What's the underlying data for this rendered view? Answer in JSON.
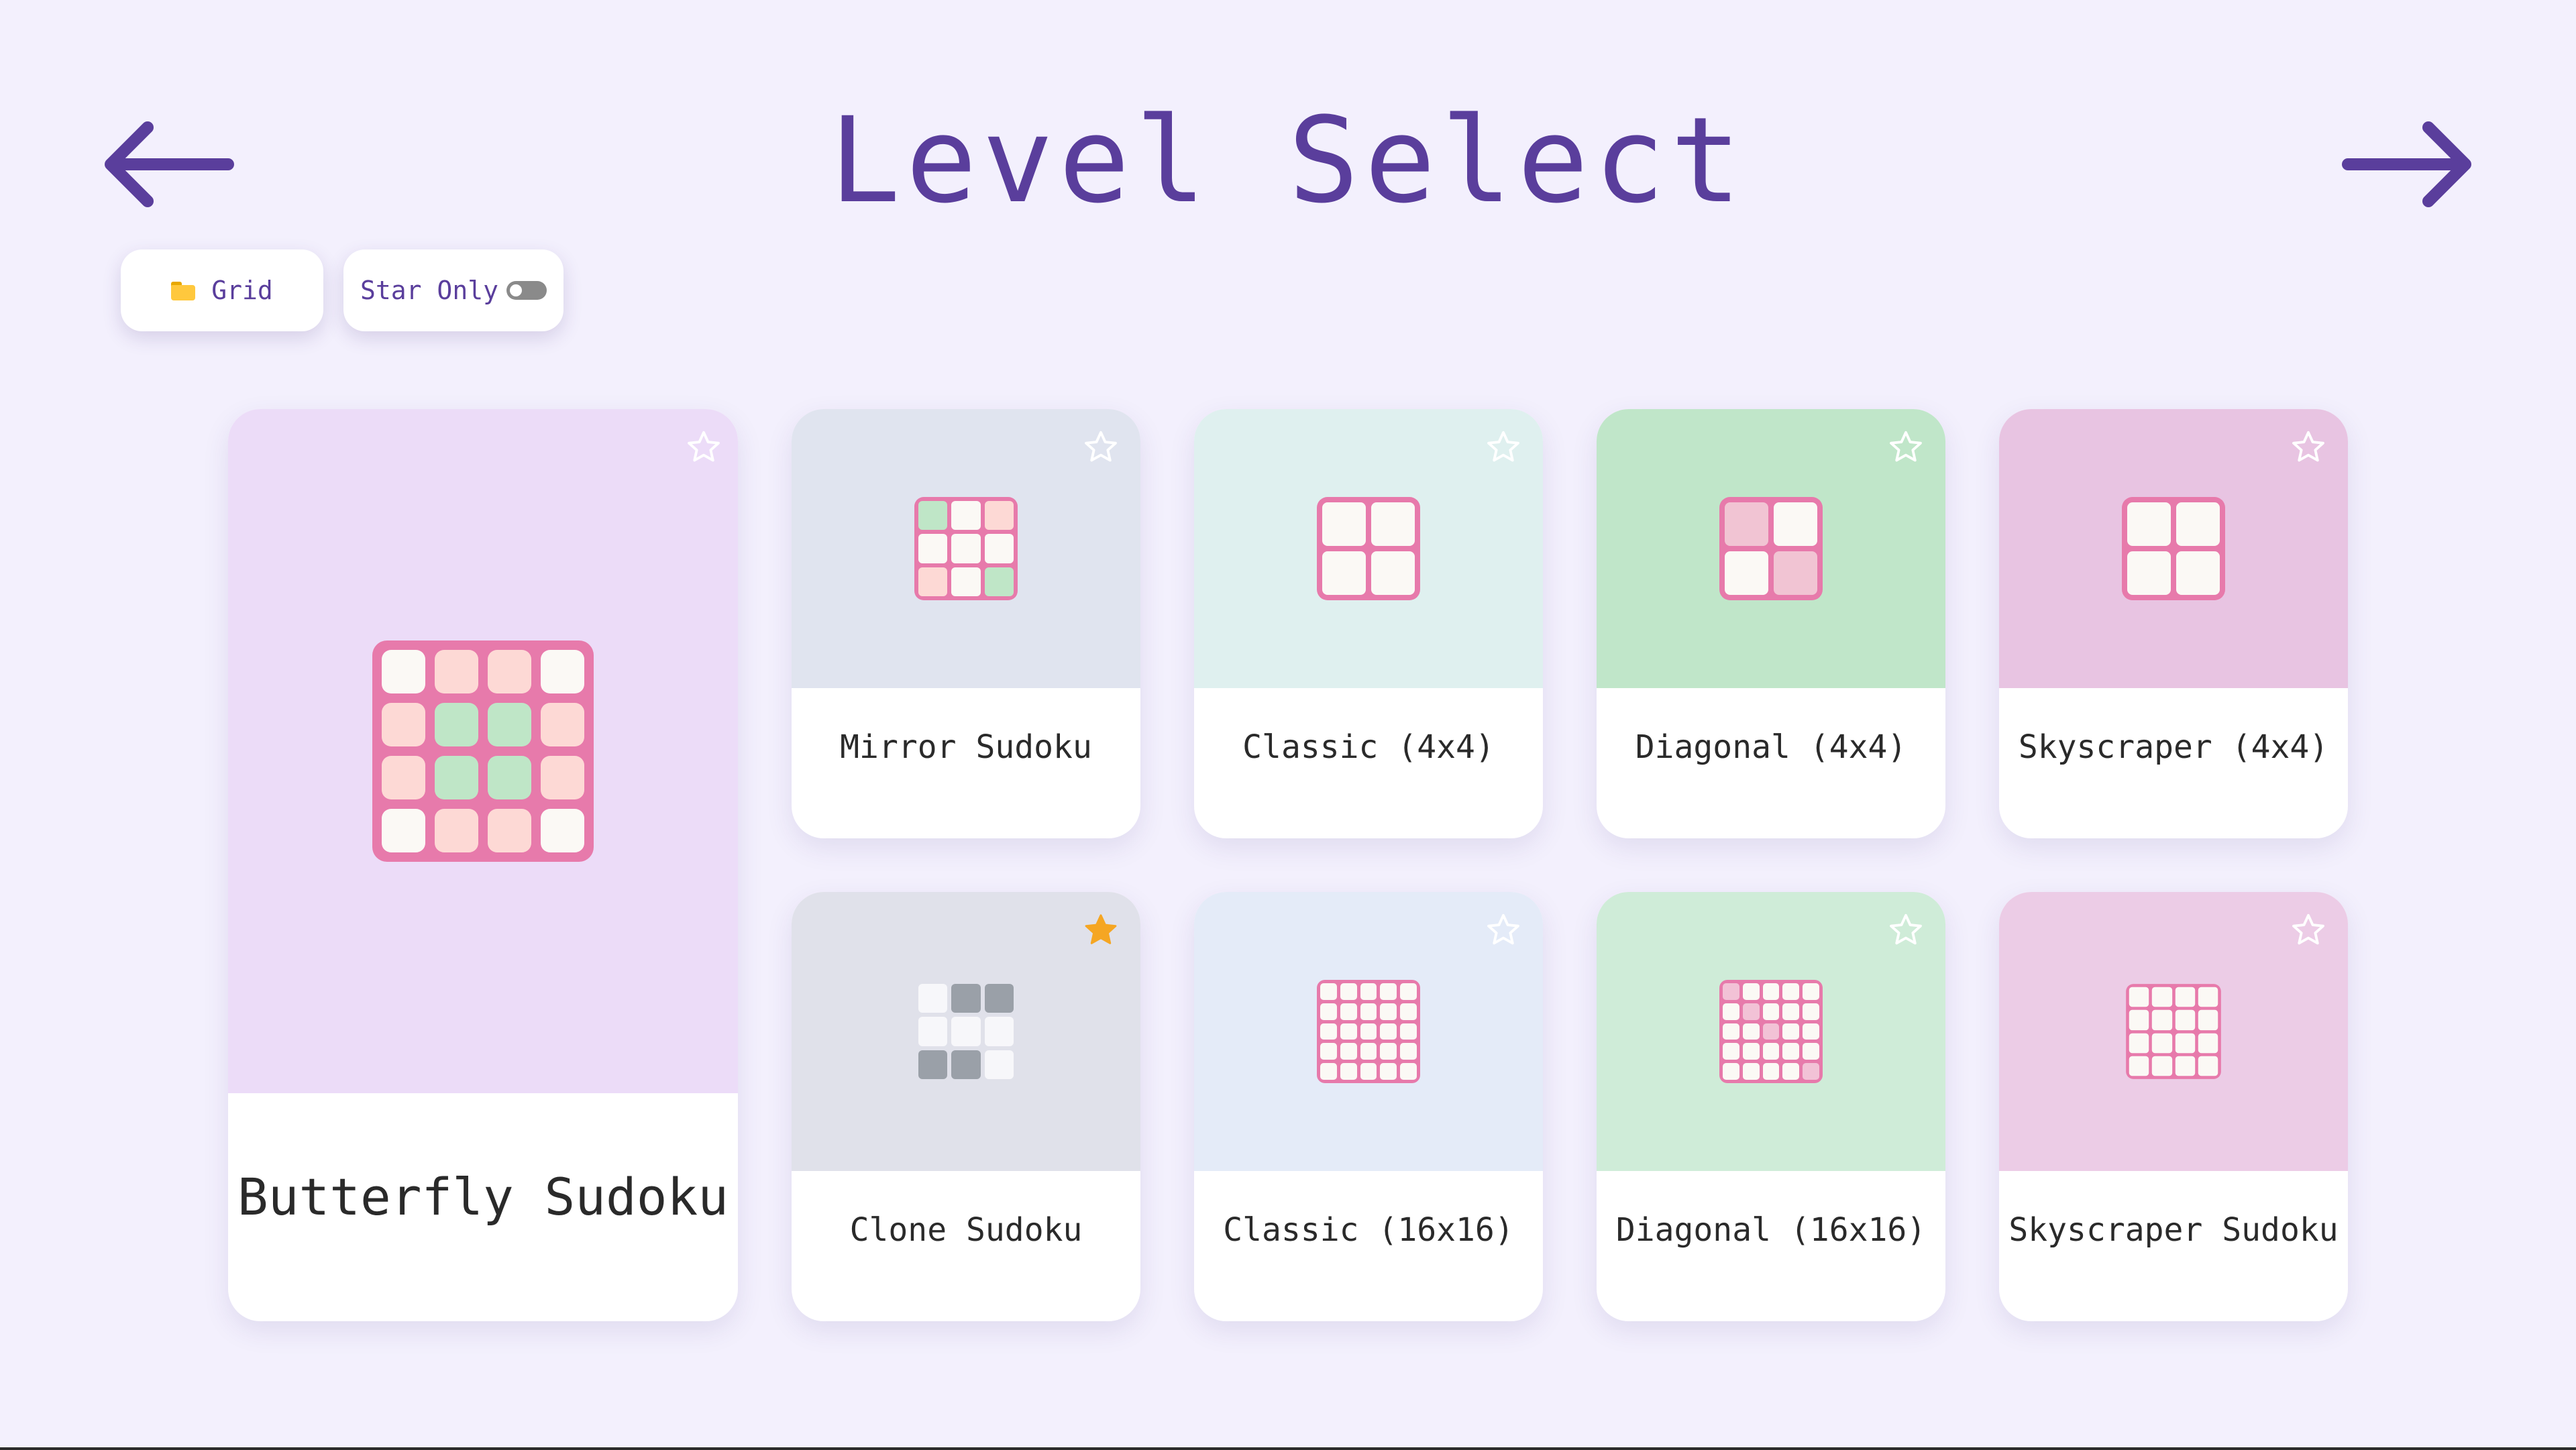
{
  "header": {
    "title": "Level Select",
    "prev_label": "previous-page",
    "next_label": "next-page"
  },
  "toolbar": {
    "grid_label": "Grid",
    "star_only_label": "Star Only",
    "star_only_enabled": false
  },
  "colors": {
    "background": "#f3f0fd",
    "accent": "#5a3e9c",
    "grid_border": "#e77aab",
    "star_filled": "#f5a623"
  },
  "levels": [
    {
      "name": "Butterfly Sudoku",
      "starred": false,
      "thumb_color": "#ecdcf8",
      "icon": "butterfly-sudoku-grid-icon"
    },
    {
      "name": "Mirror Sudoku",
      "starred": false,
      "thumb_color": "#e0e4ef",
      "icon": "mirror-sudoku-grid-icon"
    },
    {
      "name": "Classic (4x4)",
      "starred": false,
      "thumb_color": "#dff0ef",
      "icon": "classic-4x4-grid-icon"
    },
    {
      "name": "Diagonal (4x4)",
      "starred": false,
      "thumb_color": "#c0e6c9",
      "icon": "diagonal-4x4-grid-icon"
    },
    {
      "name": "Skyscraper (4x4)",
      "starred": false,
      "thumb_color": "#e8c4e2",
      "icon": "skyscraper-4x4-grid-icon"
    },
    {
      "name": "Clone Sudoku",
      "starred": true,
      "thumb_color": "#e0e1ea",
      "icon": "clone-sudoku-grid-icon"
    },
    {
      "name": "Classic (16x16)",
      "starred": false,
      "thumb_color": "#e4ebf8",
      "icon": "classic-16x16-grid-icon"
    },
    {
      "name": "Diagonal (16x16)",
      "starred": false,
      "thumb_color": "#cfecd8",
      "icon": "diagonal-16x16-grid-icon"
    },
    {
      "name": "Skyscraper Sudoku",
      "starred": false,
      "thumb_color": "#eccce6",
      "icon": "skyscraper-sudoku-grid-icon"
    }
  ]
}
